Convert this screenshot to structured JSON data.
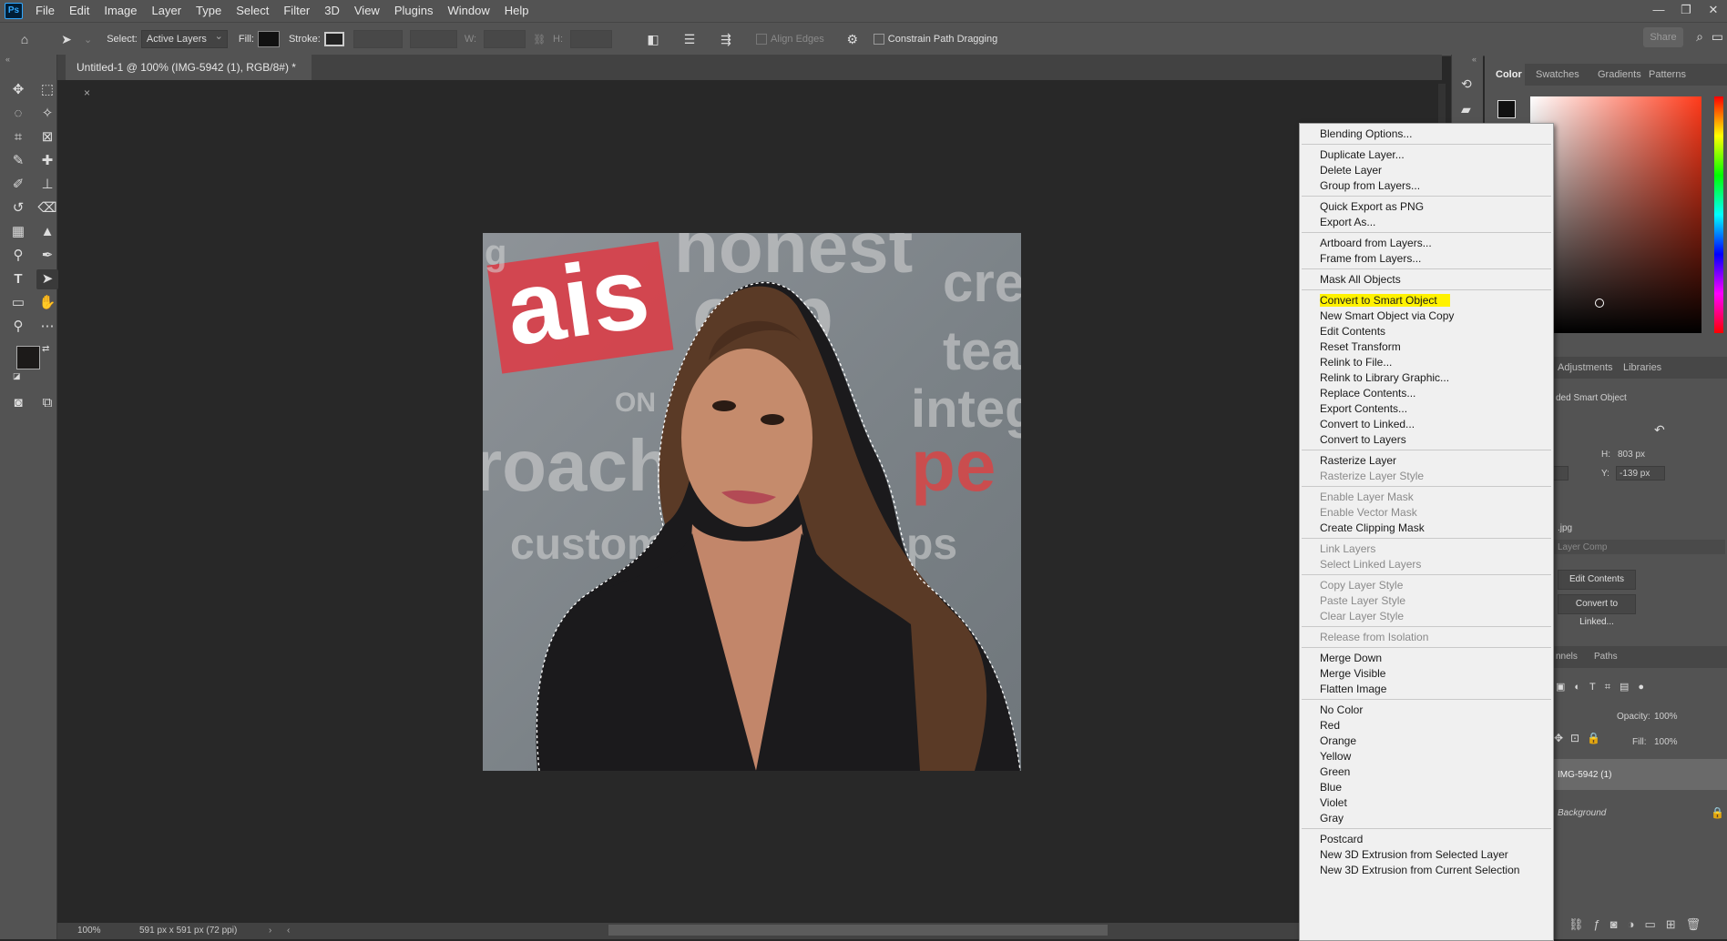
{
  "menubar": {
    "logo": "Ps",
    "items": [
      "File",
      "Edit",
      "Image",
      "Layer",
      "Type",
      "Select",
      "Filter",
      "3D",
      "View",
      "Plugins",
      "Window",
      "Help"
    ]
  },
  "options_bar": {
    "select_label": "Select:",
    "select_value": "Active Layers",
    "fill_label": "Fill:",
    "stroke_label": "Stroke:",
    "w_label": "W:",
    "h_label": "H:",
    "align_edges": "Align Edges",
    "constrain": "Constrain Path Dragging",
    "share": "Share"
  },
  "document": {
    "tab_title": "Untitled-1 @ 100% (IMG-5942 (1), RGB/8#) *",
    "zoom": "100%",
    "doc_info": "591 px x 591 px (72 ppi)"
  },
  "canvas_text": {
    "sign": "ais",
    "words": [
      "honest",
      "cre",
      "tea",
      "integ",
      "roach",
      "pe",
      "custom",
      "ps",
      "ON",
      "cap",
      "g"
    ]
  },
  "right_panel": {
    "color_tabs": [
      "Color",
      "Swatches",
      "Gradients",
      "Patterns"
    ],
    "prop_tabs": [
      "Adjustments",
      "Libraries"
    ],
    "prop_title": "ded Smart Object",
    "h_label": "H:",
    "h_value": "803 px",
    "y_label": "Y:",
    "y_value": "-139 px",
    "file_ext": ".jpg",
    "layer_comp": "Layer Comp",
    "edit_contents": "Edit Contents",
    "convert_linked": "Convert to Linked...",
    "layer_tabs": [
      "nnels",
      "Paths"
    ],
    "opacity_label": "Opacity:",
    "opacity_value": "100%",
    "fill_label": "Fill:",
    "fill_value": "100%",
    "layers": [
      "IMG-5942 (1)",
      "Background"
    ]
  },
  "context_menu": {
    "groups": [
      [
        {
          "label": "Blending Options...",
          "enabled": true
        }
      ],
      [
        {
          "label": "Duplicate Layer...",
          "enabled": true
        },
        {
          "label": "Delete Layer",
          "enabled": true
        },
        {
          "label": "Group from Layers...",
          "enabled": true
        }
      ],
      [
        {
          "label": "Quick Export as PNG",
          "enabled": true
        },
        {
          "label": "Export As...",
          "enabled": true
        }
      ],
      [
        {
          "label": "Artboard from Layers...",
          "enabled": true
        },
        {
          "label": "Frame from Layers...",
          "enabled": true
        }
      ],
      [
        {
          "label": "Mask All Objects",
          "enabled": true
        }
      ],
      [
        {
          "label": "Convert to Smart Object",
          "enabled": true,
          "highlighted": true
        },
        {
          "label": "New Smart Object via Copy",
          "enabled": true
        },
        {
          "label": "Edit Contents",
          "enabled": true
        },
        {
          "label": "Reset Transform",
          "enabled": true
        },
        {
          "label": "Relink to File...",
          "enabled": true
        },
        {
          "label": "Relink to Library Graphic...",
          "enabled": true
        },
        {
          "label": "Replace Contents...",
          "enabled": true
        },
        {
          "label": "Export Contents...",
          "enabled": true
        },
        {
          "label": "Convert to Linked...",
          "enabled": true
        },
        {
          "label": "Convert to Layers",
          "enabled": true
        }
      ],
      [
        {
          "label": "Rasterize Layer",
          "enabled": true
        },
        {
          "label": "Rasterize Layer Style",
          "enabled": false
        }
      ],
      [
        {
          "label": "Enable Layer Mask",
          "enabled": false
        },
        {
          "label": "Enable Vector Mask",
          "enabled": false
        },
        {
          "label": "Create Clipping Mask",
          "enabled": true
        }
      ],
      [
        {
          "label": "Link Layers",
          "enabled": false
        },
        {
          "label": "Select Linked Layers",
          "enabled": false
        }
      ],
      [
        {
          "label": "Copy Layer Style",
          "enabled": false
        },
        {
          "label": "Paste Layer Style",
          "enabled": false
        },
        {
          "label": "Clear Layer Style",
          "enabled": false
        }
      ],
      [
        {
          "label": "Release from Isolation",
          "enabled": false
        }
      ],
      [
        {
          "label": "Merge Down",
          "enabled": true
        },
        {
          "label": "Merge Visible",
          "enabled": true
        },
        {
          "label": "Flatten Image",
          "enabled": true
        }
      ],
      [
        {
          "label": "No Color",
          "enabled": true
        },
        {
          "label": "Red",
          "enabled": true
        },
        {
          "label": "Orange",
          "enabled": true
        },
        {
          "label": "Yellow",
          "enabled": true
        },
        {
          "label": "Green",
          "enabled": true
        },
        {
          "label": "Blue",
          "enabled": true
        },
        {
          "label": "Violet",
          "enabled": true
        },
        {
          "label": "Gray",
          "enabled": true
        }
      ],
      [
        {
          "label": "Postcard",
          "enabled": true
        },
        {
          "label": "New 3D Extrusion from Selected Layer",
          "enabled": true
        },
        {
          "label": "New 3D Extrusion from Current Selection",
          "enabled": true
        }
      ]
    ]
  },
  "colors": {
    "highlight": "#fff200",
    "accent": "#31a8ff"
  }
}
